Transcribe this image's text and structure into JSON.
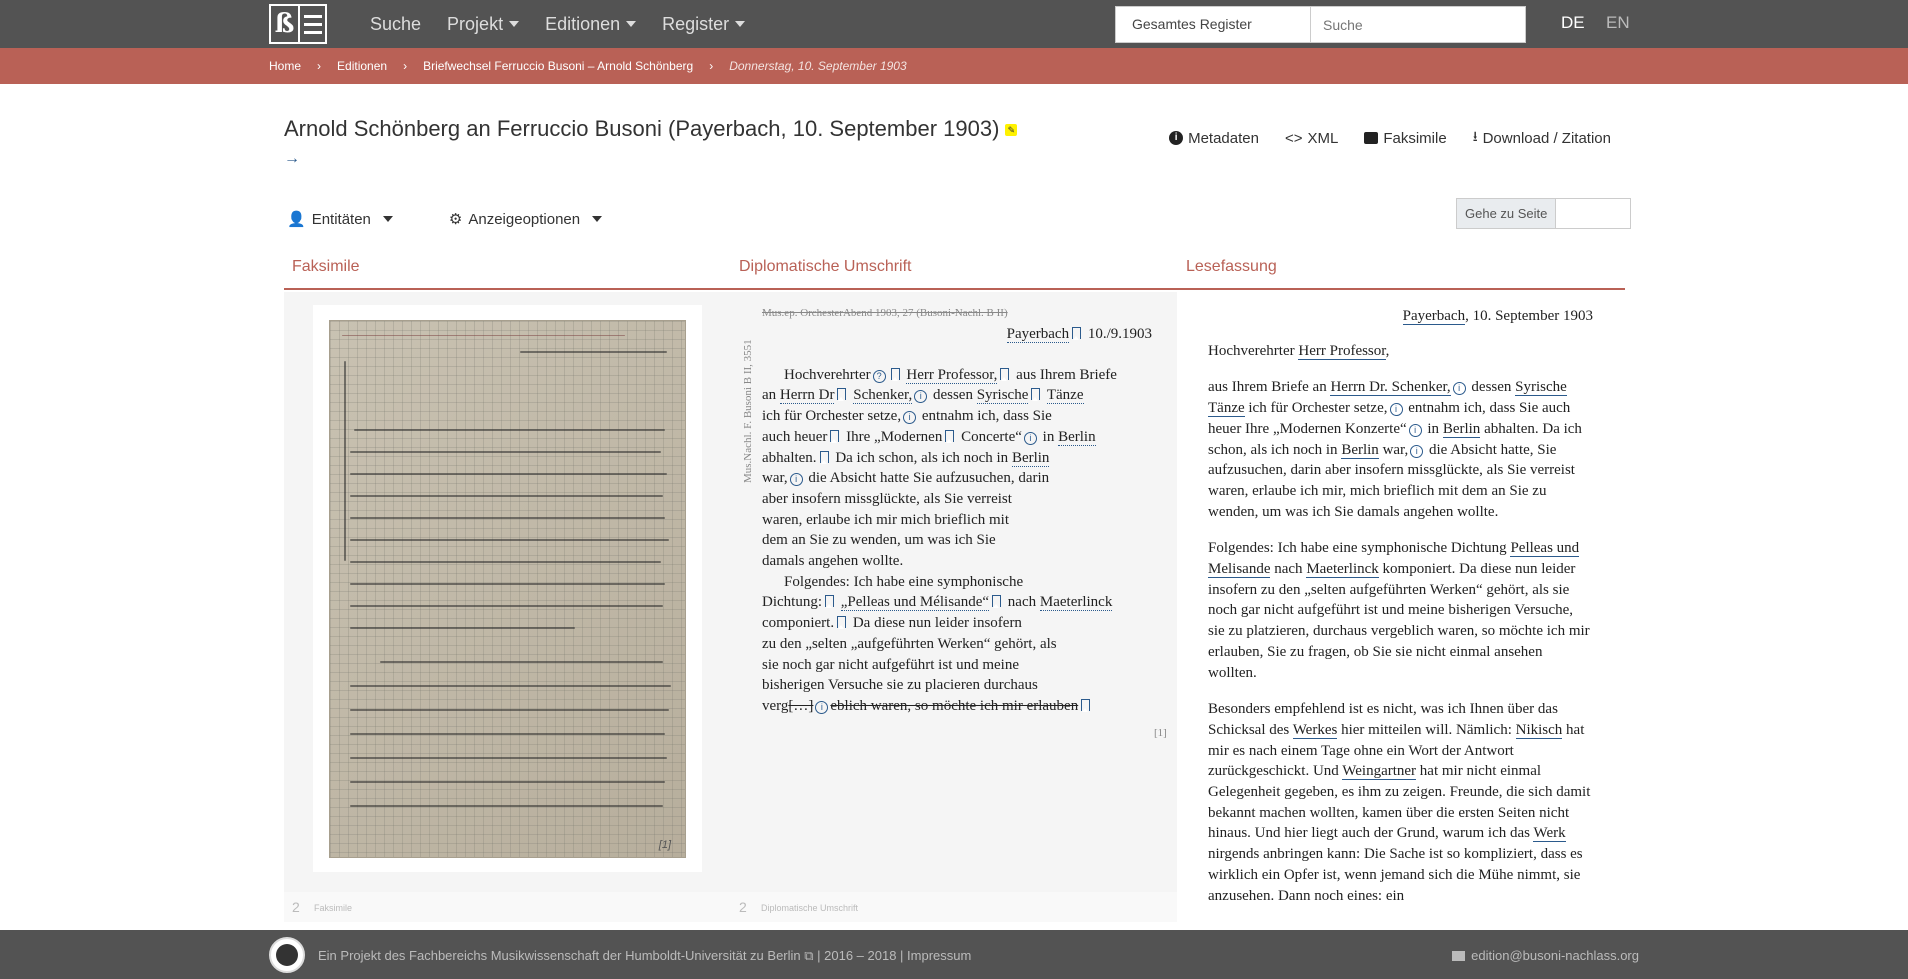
{
  "nav": {
    "items": [
      {
        "label": "Suche",
        "dropdown": false
      },
      {
        "label": "Projekt",
        "dropdown": true
      },
      {
        "label": "Editionen",
        "dropdown": true
      },
      {
        "label": "Register",
        "dropdown": true
      }
    ],
    "search_scope": "Gesamtes Register",
    "search_placeholder": "Suche",
    "lang_de": "DE",
    "lang_en": "EN"
  },
  "breadcrumb": {
    "home": "Home",
    "editionen": "Editionen",
    "correspondence": "Briefwechsel Ferruccio Busoni – Arnold Schönberg",
    "current": "Donnerstag, 10. September 1903"
  },
  "header": {
    "title": "Arnold Schönberg an Ferruccio Busoni (Payerbach, 10. September 1903)",
    "next_arrow": "→",
    "actions": {
      "metadata": "Metadaten",
      "xml": "XML",
      "facsimile": "Faksimile",
      "download": "Download / Zitation"
    }
  },
  "toolbar": {
    "entities": "Entitäten",
    "display_options": "Anzeigeoptionen",
    "goto_page": "Gehe zu Seite"
  },
  "columns": {
    "facsimile": "Faksimile",
    "diplomatic": "Diplomatische Umschrift",
    "reading": "Lesefassung"
  },
  "facsimile": {
    "page_label": "[1]"
  },
  "diplomatic": {
    "shelfmark_struck": "Mus.ep. OrchesterAbend 1903, 27 (Busoni-Nachl. B II)",
    "side_signature": "Mus.Nachl. F. Busoni B II, 3551",
    "place": "Payerbach",
    "date": "10./9.1903",
    "l1a": "Hochverehrter",
    "l1b": "Herr Professor,",
    "l1c": "aus Ihrem Briefe",
    "l2a": "an",
    "l2b": "Herrn Dr",
    "l2c": "Schenker,",
    "l2d": "dessen",
    "l2e": "Syrische",
    "l2f": "Tänze",
    "l3": "ich für Orchester setze,",
    "l3b": "entnahm ich, dass Sie",
    "l4a": "auch heuer",
    "l4b": "Ihre „Modernen",
    "l4c": "Concerte“",
    "l4d": "in",
    "l4e": "Berlin",
    "l5a": "abhalten.",
    "l5b": "Da ich schon, als ich noch in",
    "l5c": "Berlin",
    "l6a": "war,",
    "l6b": "die Absicht hatte Sie aufzusuchen, darin",
    "l7": "aber insofern missglückte, als Sie verreist",
    "l8": "waren, erlaube ich mir mich brieflich mit",
    "l9": "dem an Sie zu wenden, um was ich Sie",
    "l10": "damals angehen wollte.",
    "l11": "Folgendes: Ich habe eine symphonische",
    "l12a": "Dichtung:",
    "l12b": "„Pelleas und Mélisande“",
    "l12c": "nach",
    "l12d": "Maeterlinck",
    "l13a": "componiert.",
    "l13b": "Da diese nun leider insofern",
    "l14": "zu den „selten „aufgeführten Werken“ gehört, als",
    "l15": "sie noch gar nicht aufgeführt ist und meine",
    "l16": "bisherigen Versuche sie zu placieren durchaus",
    "l17a": "verg",
    "l17b": "[…]",
    "l17c": "eblich waren, so möchte ich mir erlauben",
    "page_mark": "[1]"
  },
  "reading": {
    "place": "Payerbach",
    "date": ", 10. September 1903",
    "salutation_a": "Hochverehrter",
    "salutation_b": "Herr Professor",
    "salutation_c": ",",
    "p1": [
      "aus Ihrem Briefe an ",
      "Herrn Dr. Schenker,",
      " dessen ",
      "Syrische Tänze",
      " ich für Orchester setze,",
      " entnahm ich, dass Sie auch heuer Ihre „Modernen Konzerte“",
      " in ",
      "Berlin",
      " abhalten. Da ich schon, als ich noch in ",
      "Berlin",
      " war,",
      " die Absicht hatte, Sie aufzusuchen, darin aber insofern missglückte, als Sie verreist waren, erlaube ich mir, mich brieflich mit dem an Sie zu wenden, um was ich Sie damals angehen wollte."
    ],
    "p2": [
      "Folgendes: Ich habe eine symphonische Dichtung ",
      "Pelleas und Melisande",
      " nach ",
      "Maeterlinck",
      " komponiert. Da diese nun leider insofern zu den „selten aufgeführten Werken“ gehört, als sie noch gar nicht aufgeführt ist und meine bisherigen Versuche, sie zu platzieren, durchaus vergeblich waren, so möchte ich mir erlauben, Sie zu fragen, ob Sie sie nicht einmal ansehen wollten."
    ],
    "p3": [
      "Besonders empfehlend ist es nicht, was ich Ihnen über das Schicksal des ",
      "Werkes",
      " hier mitteilen will. Nämlich: ",
      "Nikisch",
      " hat mir es nach einem Tage ohne ein Wort der Antwort zurückgeschickt. Und ",
      "Weingartner",
      " hat mir nicht einmal Gelegenheit gegeben, es ihm zu zeigen. Freunde, die sich damit bekannt machen wollten, kamen über die ersten Seiten nicht hinaus. Und hier liegt auch der Grund, warum ich das ",
      "Werk",
      " nirgends anbringen kann: Die Sache ist so kompliziert, dass es wirklich ein Opfer ist, wenn jemand sich die Mühe nimmt, sie anzusehen. Dann noch eines: ein"
    ]
  },
  "subrow": {
    "n1": "2",
    "t1": "Faksimile",
    "n2": "2",
    "t2": "Diplomatische Umschrift"
  },
  "footer": {
    "text": "Ein Projekt des Fachbereichs Musikwissenschaft der Humboldt-Universität zu Berlin ⧉ | 2016 – 2018 | Impressum",
    "email": "edition@busoni-nachlass.org"
  },
  "colors": {
    "accent": "#b96156",
    "topbar": "#535353",
    "link": "#2b5a8c"
  }
}
